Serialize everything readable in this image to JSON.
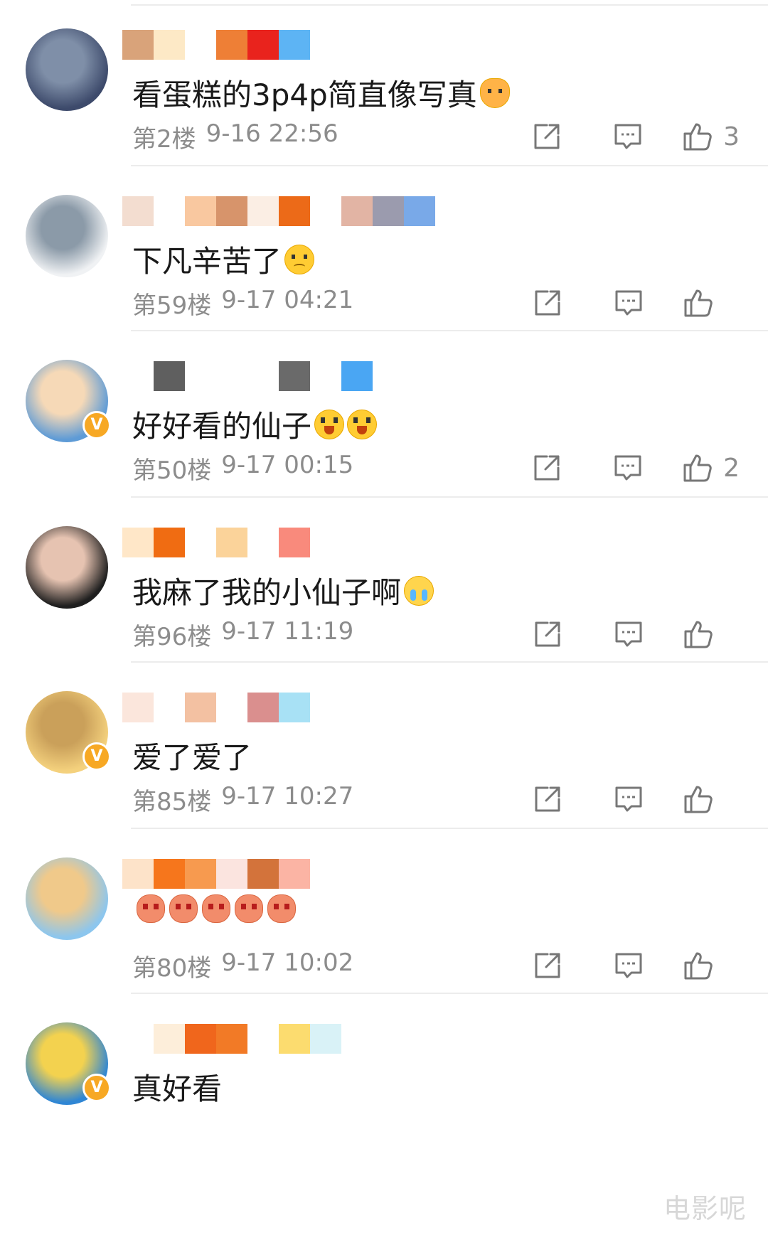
{
  "comments": [
    {
      "text": "看蛋糕的3p4p简直像写真",
      "floor": "第2楼",
      "time": "9-16 22:56",
      "likes": "3",
      "verified": false,
      "emojis": [
        "cat"
      ],
      "name_blocks": [
        "#d9a37a",
        "#fde9c6",
        "#ffffff",
        "#ee7f36",
        "#e9231d",
        "#5db4f4"
      ],
      "avatar_colors": [
        "#3d4a6b",
        "#7f8fa8"
      ]
    },
    {
      "text": "下凡辛苦了",
      "floor": "第59楼",
      "time": "9-17 04:21",
      "likes": "",
      "verified": false,
      "emojis": [
        "sad"
      ],
      "name_blocks": [
        "#f3ddd0",
        "#ffffff",
        "#f9c8a0",
        "#d7946b",
        "#fbeee4",
        "#ec6a18",
        "#ffffff",
        "#e2b4a4",
        "#9b9bae",
        "#79a9e8"
      ],
      "avatar_colors": [
        "#f0f2f4",
        "#8b9aa8"
      ]
    },
    {
      "text": "好好看的仙子",
      "floor": "第50楼",
      "time": "9-17 00:15",
      "likes": "2",
      "verified": true,
      "emojis": [
        "wow",
        "wow"
      ],
      "name_blocks": [
        "#ffffff",
        "#5f5f5f",
        "#ffffff",
        "#ffffff",
        "#ffffff",
        "#6a6a6a",
        "#ffffff",
        "#4aa6f3"
      ],
      "avatar_colors": [
        "#5e9bd6",
        "#f6d9b7"
      ]
    },
    {
      "text": "我麻了我的小仙子啊",
      "floor": "第96楼",
      "time": "9-17 11:19",
      "likes": "",
      "verified": false,
      "emojis": [
        "cry"
      ],
      "name_blocks": [
        "#ffe7c8",
        "#f06c12",
        "#ffffff",
        "#fbd39a",
        "#ffffff",
        "#f98a7c"
      ],
      "avatar_colors": [
        "#1f1f1f",
        "#e6c3b1"
      ]
    },
    {
      "text": "爱了爱了",
      "floor": "第85楼",
      "time": "9-17 10:27",
      "likes": "",
      "verified": true,
      "emojis": [],
      "name_blocks": [
        "#fbe6dc",
        "#ffffff",
        "#f3c1a2",
        "#ffffff",
        "#da8f8e",
        "#a8e1f5"
      ],
      "avatar_colors": [
        "#f4d17d",
        "#caa05a"
      ]
    },
    {
      "text": "",
      "floor": "第80楼",
      "time": "9-17 10:02",
      "likes": "",
      "verified": false,
      "emojis": [
        "bear",
        "bear",
        "bear",
        "bear",
        "bear"
      ],
      "name_blocks": [
        "#fde3c9",
        "#f6761c",
        "#f79a4f",
        "#fbe4df",
        "#d3733b",
        "#fbb4a4"
      ],
      "avatar_colors": [
        "#8cc6ee",
        "#f0c98a"
      ]
    },
    {
      "text": "真好看",
      "floor": "",
      "time": "",
      "likes": "",
      "verified": true,
      "emojis": [],
      "name_blocks": [
        "#ffffff",
        "#fdeeda",
        "#f0661c",
        "#f27a26",
        "#ffffff",
        "#fcdc6f",
        "#d9f2f7"
      ],
      "avatar_colors": [
        "#2f86d4",
        "#f3d24f"
      ]
    }
  ],
  "icons": {
    "share": "share-icon",
    "reply": "comment-icon",
    "like": "thumbs-up-icon",
    "badge": "verified-badge-icon"
  },
  "badge_mark": "V",
  "watermark": "电影呢",
  "colors": {
    "meta_text": "#8c8c8c",
    "body_text": "#1a1a1a",
    "badge": "#f7a824",
    "divider": "#ececec"
  }
}
